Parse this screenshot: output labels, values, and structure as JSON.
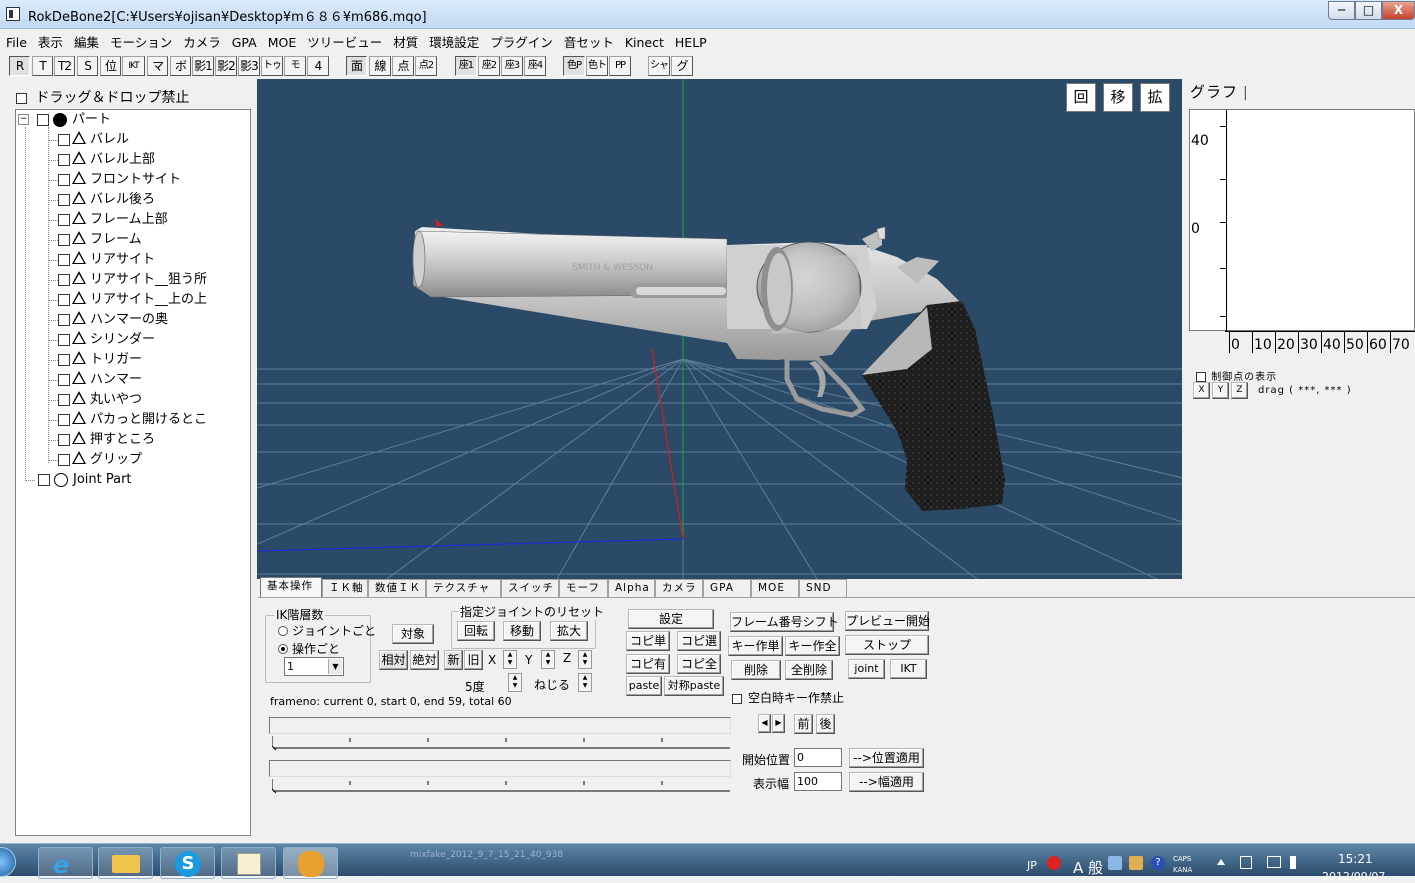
{
  "window": {
    "title": "RokDeBone2[C:¥Users¥ojisan¥Desktop¥m６８６¥m686.mqo]",
    "min_label": "─",
    "max_label": "□",
    "close_label": "X"
  },
  "menu": [
    "File",
    "表示",
    "編集",
    "モーション",
    "カメラ",
    "GPA",
    "MOE",
    "ツリービュー",
    "材質",
    "環境設定",
    "プラグイン",
    "音セット",
    "Kinect",
    "HELP"
  ],
  "toolbar": [
    "R",
    "T",
    "T2",
    "S",
    "位",
    "IKT",
    "マ",
    "ボ",
    "影1",
    "影2",
    "影3",
    "トゥ",
    "モ",
    "4",
    "面",
    "線",
    "点",
    "点2",
    "座1",
    "座2",
    "座3",
    "座4",
    "色P",
    "色ト",
    "PP",
    "シャ",
    "グ"
  ],
  "sidebar": {
    "dnd_label": "ドラッグ＆ドロップ禁止"
  },
  "tree": {
    "root": "パート",
    "expander": "−",
    "children": [
      "バレル",
      "バレル上部",
      "フロントサイト",
      "バレル後ろ",
      "フレーム上部",
      "フレーム",
      "リアサイト",
      "リアサイト__狙う所",
      "リアサイト__上の上",
      "ハンマーの奥",
      "シリンダー",
      "トリガー",
      "ハンマー",
      "丸いやつ",
      "パカっと開けるとこ",
      "押すところ",
      "グリップ"
    ],
    "joint_part": "Joint Part"
  },
  "viewport": {
    "rot": "回",
    "move": "移",
    "zoom": "拡",
    "engraving": "SMITH & WESSON"
  },
  "graph": {
    "tab": "グラフ",
    "y_labels": [
      "40",
      "0"
    ],
    "x_ticks": [
      "0",
      "10",
      "20",
      "30",
      "40",
      "50",
      "60",
      "70"
    ],
    "show_ctrl_label": "制御点の表示",
    "x_btn": "X",
    "y_btn": "Y",
    "z_btn": "Z",
    "drag_label": "drag ( ***, *** )"
  },
  "tabs": [
    "基本操作",
    "ＩＫ軸",
    "数値ＩＫ",
    "テクスチャ",
    "スイッチ",
    "モーフ",
    "Alpha",
    "カメラ",
    "GPA",
    "MOE",
    "SND"
  ],
  "panel": {
    "ik_group": "IK階層数",
    "radio_joint": "ジョイントごと",
    "radio_op": "操作ごと",
    "ik_select": "1",
    "target_btn": "対象",
    "reset_group": "指定ジョイントのリセット",
    "reset_rot": "回転",
    "reset_move": "移動",
    "reset_zoom": "拡大",
    "relative": "相対",
    "absolute": "絶対",
    "new": "新",
    "old": "旧",
    "x": "X",
    "y": "Y",
    "z": "Z",
    "deg": "5度",
    "twist": "ねじる",
    "frameinfo": "frameno: current 0, start 0, end 59, total 60",
    "settings": "設定",
    "copy_single": "コピ単",
    "copy_sel": "コピ選",
    "copy_has": "コピ有",
    "copy_all": "コピ全",
    "paste": "paste",
    "sym_paste": "対称paste",
    "frame_shift": "フレーム番号シフト",
    "key_single": "キー作単",
    "key_all": "キー作全",
    "delete": "削除",
    "delete_all": "全削除",
    "preview": "プレビュー開始",
    "stop": "ストップ",
    "joint": "joint",
    "ikt": "IKT",
    "no_key_empty": "空白時キー作禁止",
    "prev_arrow": "◀",
    "next_arrow": "▶",
    "prev": "前",
    "next": "後",
    "start_label": "開始位置",
    "start_value": "0",
    "apply_pos": "-->位置適用",
    "width_label": "表示幅",
    "width_value": "100",
    "apply_width": "-->幅適用"
  },
  "taskbar": {
    "lang": "JP",
    "ime": "A 般",
    "caps": "CAPS",
    "kana": "KANA",
    "time": "15:21",
    "date": "2012/09/07",
    "task_text": "mixfake_2012_9_7_15_21_40_938"
  }
}
